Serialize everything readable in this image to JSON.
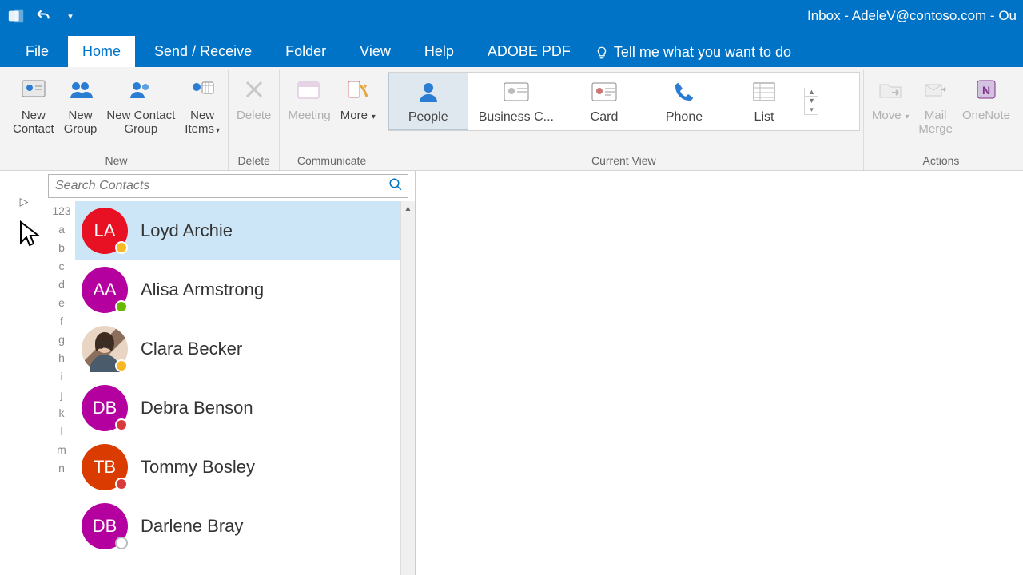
{
  "title": "Inbox - AdeleV@contoso.com  -  Ou",
  "tabs": {
    "file": "File",
    "home": "Home",
    "send_receive": "Send / Receive",
    "folder": "Folder",
    "view": "View",
    "help": "Help",
    "adobe": "ADOBE PDF",
    "tell_me": "Tell me what you want to do"
  },
  "ribbon": {
    "new": {
      "label": "New",
      "new_contact": "New\nContact",
      "new_group": "New\nGroup",
      "new_contact_group": "New Contact\nGroup",
      "new_items": "New\nItems"
    },
    "delete": {
      "label": "Delete",
      "delete": "Delete"
    },
    "communicate": {
      "label": "Communicate",
      "meeting": "Meeting",
      "more": "More"
    },
    "current_view": {
      "label": "Current View",
      "people": "People",
      "business": "Business C...",
      "card": "Card",
      "phone": "Phone",
      "list": "List"
    },
    "actions": {
      "label": "Actions",
      "move": "Move",
      "mail_merge": "Mail\nMerge",
      "onenote": "OneNote"
    }
  },
  "search": {
    "placeholder": "Search Contacts"
  },
  "alpha_index": [
    "123",
    "a",
    "b",
    "c",
    "d",
    "e",
    "f",
    "g",
    "h",
    "i",
    "j",
    "k",
    "l",
    "m",
    "n"
  ],
  "contacts": [
    {
      "initials": "LA",
      "name": "Loyd Archie",
      "color": "#E81123",
      "presence": "away",
      "selected": true
    },
    {
      "initials": "AA",
      "name": "Alisa Armstrong",
      "color": "#B4009E",
      "presence": "available",
      "selected": false
    },
    {
      "initials": "",
      "name": "Clara Becker",
      "color": "photo",
      "presence": "away",
      "selected": false
    },
    {
      "initials": "DB",
      "name": "Debra Benson",
      "color": "#B4009E",
      "presence": "busy",
      "selected": false
    },
    {
      "initials": "TB",
      "name": "Tommy Bosley",
      "color": "#DA3B01",
      "presence": "busy",
      "selected": false
    },
    {
      "initials": "DB",
      "name": "Darlene Bray",
      "color": "#B4009E",
      "presence": "none",
      "selected": false
    }
  ]
}
